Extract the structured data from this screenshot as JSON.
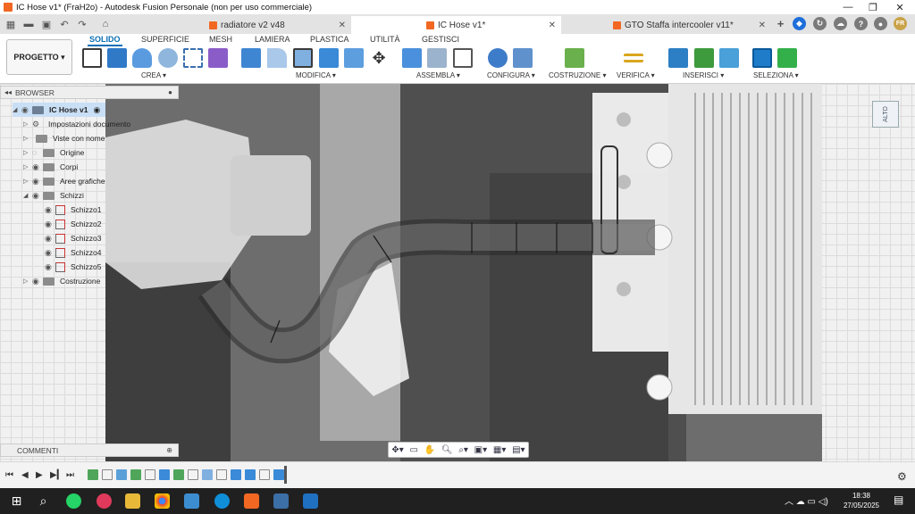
{
  "window": {
    "title": "IC Hose v1* (FraH2o) - Autodesk Fusion Personale (non per uso commerciale)",
    "controls": [
      "—",
      "❐",
      "✕"
    ]
  },
  "tabs": [
    {
      "label": "radiatore v2 v48",
      "active": false
    },
    {
      "label": "IC Hose v1*",
      "active": true
    },
    {
      "label": "GTO Staffa intercooler v11*",
      "active": false
    }
  ],
  "project_button": "PROGETTO",
  "ribbon_tabs": [
    "SOLIDO",
    "SUPERFICIE",
    "MESH",
    "LAMIERA",
    "PLASTICA",
    "UTILITÀ",
    "GESTISCI"
  ],
  "ribbon_groups": [
    "CREA ▾",
    "MODIFICA ▾",
    "ASSEMBLA ▾",
    "CONFIGURA ▾",
    "COSTRUZIONE ▾",
    "VERIFICA ▾",
    "INSERISCI ▾",
    "SELEZIONA ▾"
  ],
  "browser": {
    "title": "BROWSER",
    "root": "IC Hose v1",
    "items": [
      "Impostazioni documento",
      "Viste con nome",
      "Origine",
      "Corpi",
      "Aree grafiche",
      "Schizzi",
      "Schizzo1",
      "Schizzo2",
      "Schizzo3",
      "Schizzo4",
      "Schizzo5",
      "Costruzione"
    ]
  },
  "viewcube_label": "ALTO",
  "comments_label": "COMMENTI",
  "clock": {
    "time": "18:38",
    "date": "27/05/2025"
  },
  "colors": {
    "accent": "#0a6fb5",
    "brand": "#f26722",
    "taskbar": "#202020"
  }
}
